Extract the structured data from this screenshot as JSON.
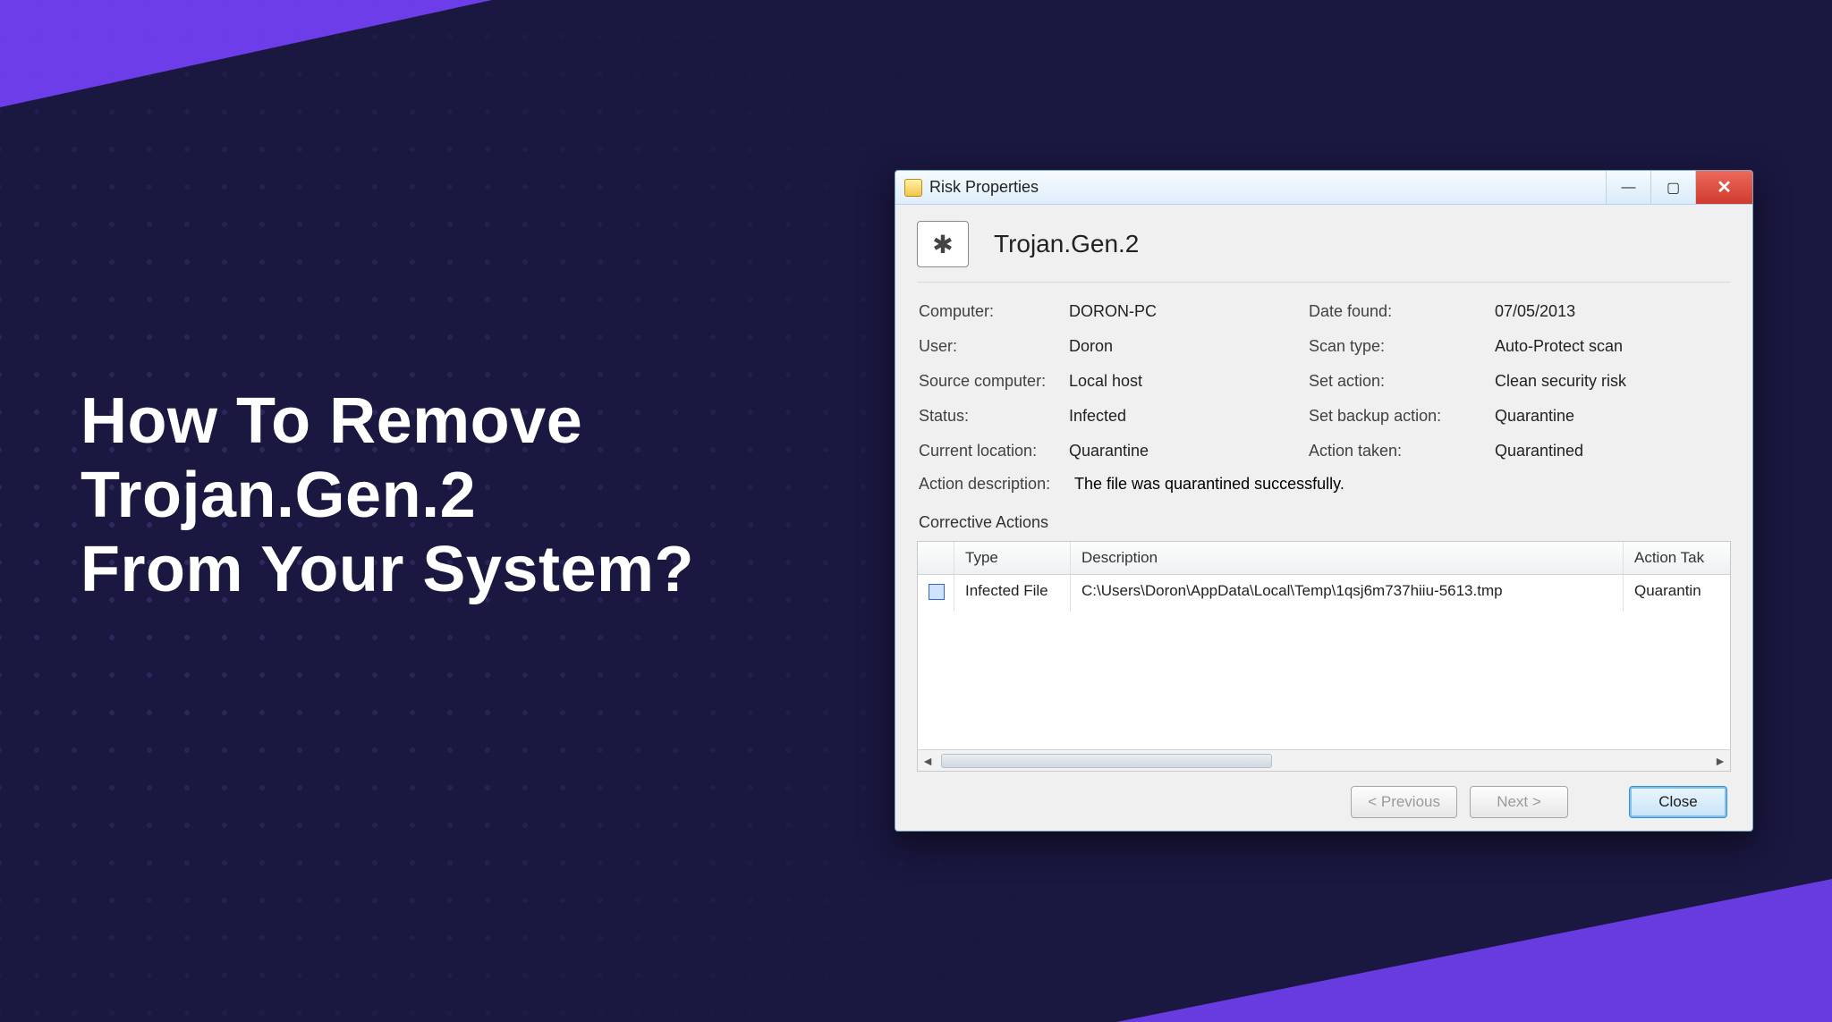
{
  "headline": {
    "line1": "How To Remove",
    "line2": "Trojan.Gen.2",
    "line3": "From Your System?"
  },
  "window": {
    "title": "Risk Properties"
  },
  "threat": {
    "name": "Trojan.Gen.2"
  },
  "labels": {
    "computer": "Computer:",
    "user": "User:",
    "source_computer": "Source computer:",
    "status": "Status:",
    "current_location": "Current location:",
    "date_found": "Date found:",
    "scan_type": "Scan type:",
    "set_action": "Set action:",
    "set_backup_action": "Set backup action:",
    "action_taken": "Action taken:",
    "action_description": "Action description:",
    "corrective_actions": "Corrective Actions"
  },
  "values": {
    "computer": "DORON-PC",
    "user": "Doron",
    "source_computer": "Local host",
    "status": "Infected",
    "current_location": "Quarantine",
    "date_found": "07/05/2013",
    "scan_type": "Auto-Protect scan",
    "set_action": "Clean security risk",
    "set_backup_action": "Quarantine",
    "action_taken": "Quarantined",
    "action_description": "The file was quarantined successfully."
  },
  "table": {
    "headers": {
      "type": "Type",
      "description": "Description",
      "action": "Action Tak"
    },
    "rows": [
      {
        "type": "Infected File",
        "description": "C:\\Users\\Doron\\AppData\\Local\\Temp\\1qsj6m737hiiu-5613.tmp",
        "action": "Quarantin"
      }
    ]
  },
  "buttons": {
    "prev": "< Previous",
    "next": "Next >",
    "close": "Close"
  }
}
